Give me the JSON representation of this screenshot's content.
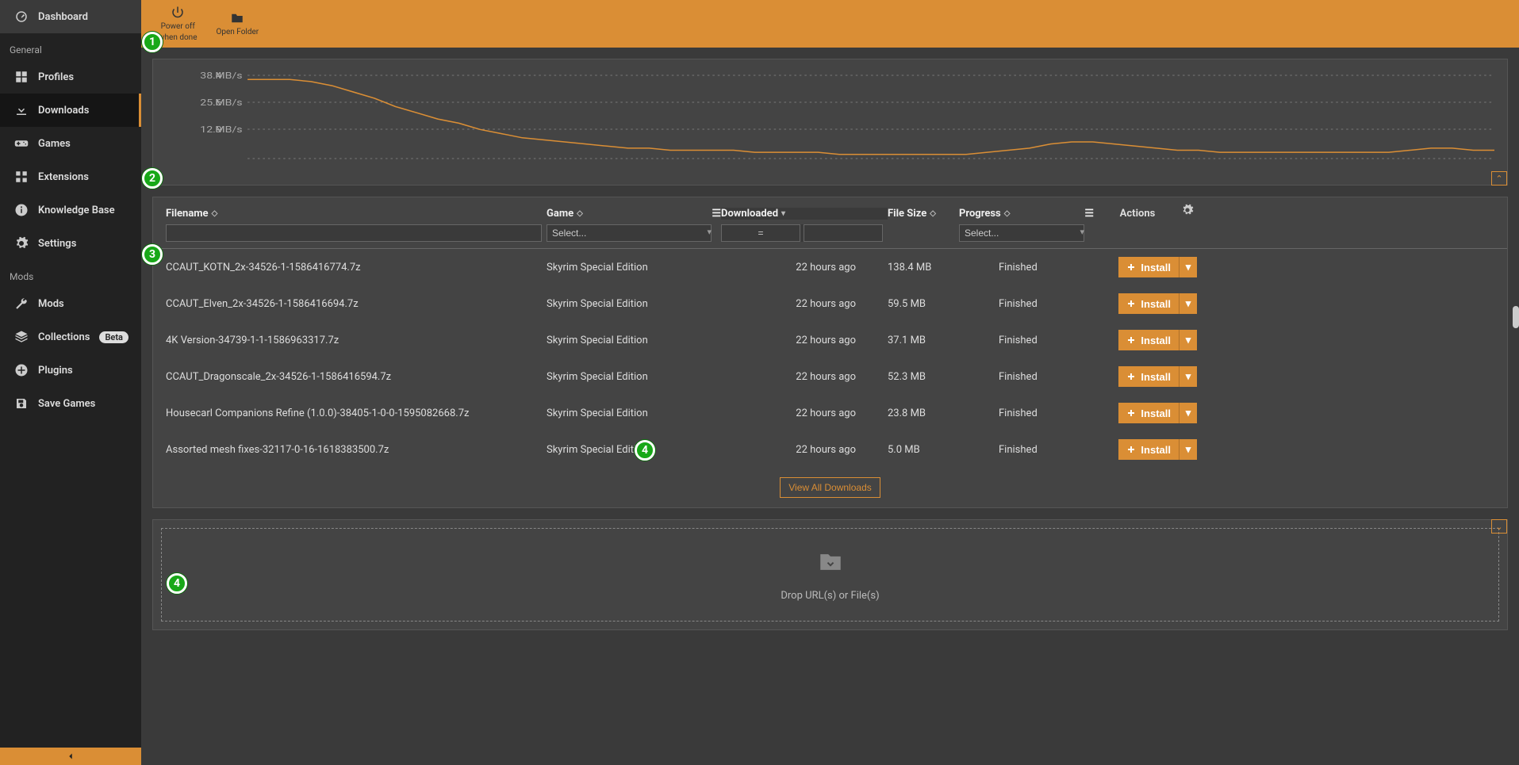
{
  "sidebar": {
    "dashboard": "Dashboard",
    "section_general": "General",
    "profiles": "Profiles",
    "downloads": "Downloads",
    "games": "Games",
    "extensions": "Extensions",
    "knowledge": "Knowledge Base",
    "settings": "Settings",
    "section_mods": "Mods",
    "mods": "Mods",
    "collections": "Collections",
    "collections_badge": "Beta",
    "plugins": "Plugins",
    "savegames": "Save Games"
  },
  "topbar": {
    "poweroff_line1": "Power off",
    "poweroff_line2": "when done",
    "open_folder": "Open Folder"
  },
  "chart_data": {
    "type": "line",
    "ylabel_unit": "MB/s",
    "y_ticks": [
      38.4,
      25.6,
      12.9
    ],
    "y_range": [
      0,
      40
    ],
    "x_range": [
      0,
      60
    ],
    "values": [
      38,
      38,
      38,
      37,
      35,
      32,
      29,
      25,
      22,
      19,
      17,
      14,
      12,
      10,
      9,
      8,
      7,
      6,
      5,
      5,
      4,
      4,
      4,
      4,
      3,
      3,
      3,
      3,
      2,
      2,
      2,
      2,
      2,
      2,
      2,
      3,
      4,
      5,
      7,
      8,
      8,
      7,
      6,
      5,
      4,
      4,
      3,
      3,
      3,
      3,
      3,
      3,
      3,
      3,
      3,
      4,
      5,
      5,
      4,
      4
    ]
  },
  "table": {
    "headers": {
      "filename": "Filename",
      "game": "Game",
      "downloaded": "Downloaded",
      "filesize": "File Size",
      "progress": "Progress",
      "actions": "Actions"
    },
    "filters": {
      "game_placeholder": "Select...",
      "progress_placeholder": "Select...",
      "eq_symbol": "="
    },
    "install_label": "Install",
    "view_all": "View All Downloads",
    "rows": [
      {
        "filename": "CCAUT_KOTN_2x-34526-1-1586416774.7z",
        "game": "Skyrim Special Edition",
        "downloaded": "22 hours ago",
        "filesize": "138.4 MB",
        "progress": "Finished"
      },
      {
        "filename": "CCAUT_Elven_2x-34526-1-1586416694.7z",
        "game": "Skyrim Special Edition",
        "downloaded": "22 hours ago",
        "filesize": "59.5 MB",
        "progress": "Finished"
      },
      {
        "filename": "4K Version-34739-1-1-1586963317.7z",
        "game": "Skyrim Special Edition",
        "downloaded": "22 hours ago",
        "filesize": "37.1 MB",
        "progress": "Finished"
      },
      {
        "filename": "CCAUT_Dragonscale_2x-34526-1-1586416594.7z",
        "game": "Skyrim Special Edition",
        "downloaded": "22 hours ago",
        "filesize": "52.3 MB",
        "progress": "Finished"
      },
      {
        "filename": "Housecarl Companions Refine (1.0.0)-38405-1-0-0-1595082668.7z",
        "game": "Skyrim Special Edition",
        "downloaded": "22 hours ago",
        "filesize": "23.8 MB",
        "progress": "Finished"
      },
      {
        "filename": "Assorted mesh fixes-32117-0-16-1618383500.7z",
        "game": "Skyrim Special Edition",
        "downloaded": "22 hours ago",
        "filesize": "5.0 MB",
        "progress": "Finished"
      }
    ]
  },
  "dropzone": {
    "label": "Drop URL(s) or File(s)"
  },
  "markers": {
    "m1": "1",
    "m2": "2",
    "m3": "3",
    "m4a": "4",
    "m4b": "4"
  }
}
